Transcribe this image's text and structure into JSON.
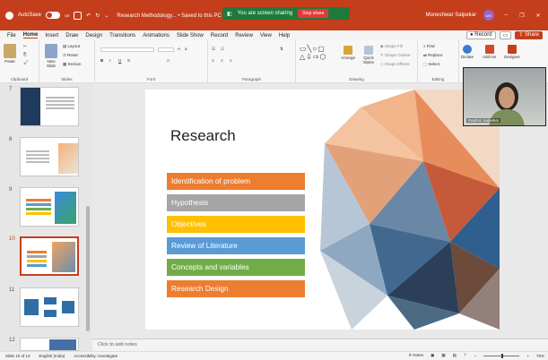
{
  "titlebar": {
    "autosave_label": "AutoSave",
    "autosave_state": "Off",
    "doc_title": "Research Methodology... • Saved to this PC ∨",
    "share_banner_text": "You are screen sharing",
    "stop_share_label": "Stop share",
    "user_name": "Moneshwar Salpekar",
    "user_initials": "MS"
  },
  "menu": {
    "items": [
      "File",
      "Home",
      "Insert",
      "Draw",
      "Design",
      "Transitions",
      "Animations",
      "Slide Show",
      "Record",
      "Review",
      "View",
      "Help"
    ],
    "active": "Home",
    "record_label": "Record",
    "share_label": "Share"
  },
  "ribbon": {
    "groups": [
      "Clipboard",
      "Slides",
      "Font",
      "Paragraph",
      "Drawing",
      "Editing"
    ],
    "paste": "Paste",
    "new_slide": "New Slide",
    "layout": "Layout",
    "reset": "Reset",
    "section": "Section",
    "arrange": "Arrange",
    "quick_styles": "Quick Styles",
    "shape_fill": "Shape Fill",
    "shape_outline": "Shape Outline",
    "shape_effects": "Shape Effects",
    "find": "Find",
    "replace": "Replace",
    "select": "Select",
    "dictate": "Dictate",
    "addins": "Add-ins",
    "designer": "Designer"
  },
  "slides_panel": {
    "numbers": [
      "7",
      "8",
      "9",
      "10",
      "11",
      "12"
    ],
    "current": "10"
  },
  "slide": {
    "title": "Research",
    "items": [
      {
        "label": "Identification of problem",
        "color": "#ed7d31"
      },
      {
        "label": "Hypothesis",
        "color": "#a5a5a5"
      },
      {
        "label": "Objectives",
        "color": "#ffc000"
      },
      {
        "label": "Review of Literature",
        "color": "#5b9bd5"
      },
      {
        "label": "Concepts and variables",
        "color": "#70ad47"
      },
      {
        "label": "Research Design",
        "color": "#ed7d31"
      }
    ]
  },
  "camera": {
    "participant_name": "Rashmi Salpekar"
  },
  "notes": {
    "placeholder": "Click to add notes"
  },
  "status": {
    "slide_position": "Slide 10 of 13",
    "language": "English (India)",
    "accessibility": "Accessibility: Investigate",
    "notes_label": "Notes",
    "zoom": "70%"
  },
  "colors": {
    "accent": "#c43e1c",
    "share_green": "#1e7a3c"
  }
}
